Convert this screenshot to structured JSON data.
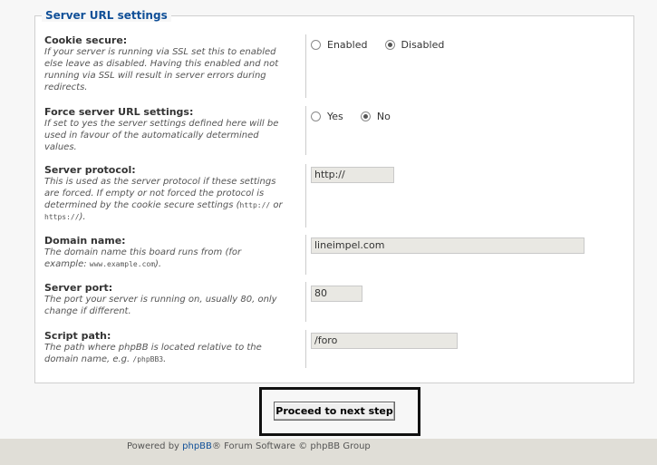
{
  "section": {
    "legend": "Server URL settings"
  },
  "settings": {
    "cookie_secure": {
      "label": "Cookie secure:",
      "desc_lines": [
        "If your server is running via SSL set this to enabled",
        "else leave as disabled. Having this enabled and not",
        "running via SSL will result in server errors during",
        "redirects."
      ],
      "options": [
        {
          "label": "Enabled",
          "checked": false
        },
        {
          "label": "Disabled",
          "checked": true
        }
      ]
    },
    "force_server_url": {
      "label": "Force server URL settings:",
      "desc_lines": [
        "If set to yes the server settings defined here will be",
        "used in favour of the automatically determined",
        "values."
      ],
      "options": [
        {
          "label": "Yes",
          "checked": false
        },
        {
          "label": "No",
          "checked": true
        }
      ]
    },
    "server_protocol": {
      "label": "Server protocol:",
      "desc_lines": [
        "This is used as the server protocol if these settings",
        "are forced. If empty or not forced the protocol is",
        "determined by the cookie secure settings ("
      ],
      "desc_code1": "http://",
      "desc_or": " or",
      "desc_code2": "https://",
      "desc_end": ").",
      "value": "http://"
    },
    "domain_name": {
      "label": "Domain name:",
      "desc_line1": "The domain name this board runs from (for",
      "desc_prefix": "example: ",
      "desc_code": "www.example.com",
      "desc_end": ").",
      "value": "lineimpel.com"
    },
    "server_port": {
      "label": "Server port:",
      "desc_lines": [
        "The port your server is running on, usually 80, only",
        "change if different."
      ],
      "value": "80"
    },
    "script_path": {
      "label": "Script path:",
      "desc_line1": "The path where phpBB is located relative to the",
      "desc_prefix": "domain name, e.g. ",
      "desc_code": "/phpBB3",
      "desc_end": ".",
      "value": "/foro"
    }
  },
  "actions": {
    "proceed_label": "Proceed to next step"
  },
  "footer": {
    "prefix": "Powered by ",
    "link": "phpBB",
    "suffix": "® Forum Software © phpBB Group"
  }
}
